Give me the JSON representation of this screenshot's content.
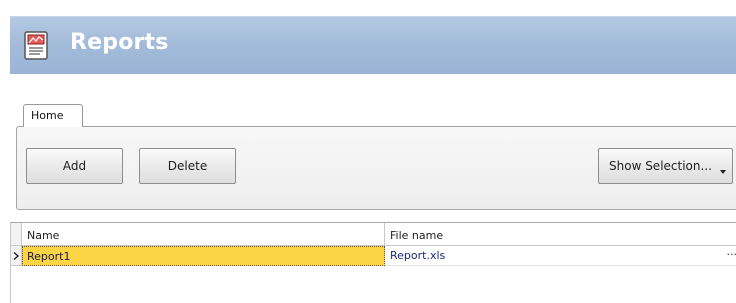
{
  "window": {
    "title": "Reports",
    "title_icon": "report-icon"
  },
  "ribbon": {
    "tabs": [
      {
        "label": "Home",
        "active": true
      }
    ],
    "buttons": {
      "add_label": "Add",
      "delete_label": "Delete",
      "show_selection_label": "Show Selection..."
    }
  },
  "grid": {
    "columns": [
      "Name",
      "File name"
    ],
    "rows": [
      {
        "name": "Report1",
        "file_name": "Report.xls",
        "selected": true,
        "ellipsis": "···"
      }
    ]
  },
  "colors": {
    "title_bar": "#a3bbda",
    "selected_cell": "#fbd545",
    "link_text": "#1d2a7a"
  }
}
